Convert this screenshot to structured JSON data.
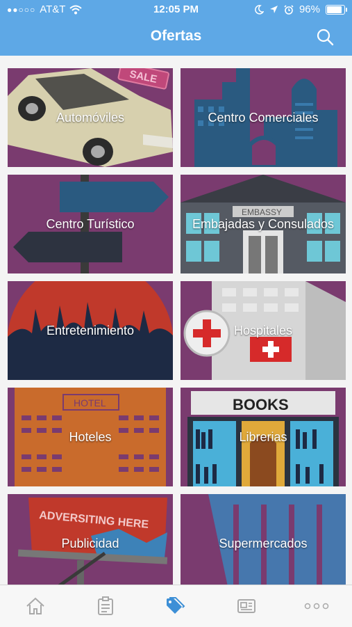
{
  "status_bar": {
    "carrier": "AT&T",
    "time": "12:05 PM",
    "battery": "96%",
    "battery_level": 0.96
  },
  "header": {
    "title": "Ofertas",
    "color": "#5ea8e6"
  },
  "categories": [
    {
      "label": "Automóviles",
      "icon": "car-image"
    },
    {
      "label": "Centro Comerciales",
      "icon": "buildings-image"
    },
    {
      "label": "Centro Turístico",
      "icon": "signpost-image"
    },
    {
      "label": "Embajadas y Consulados",
      "icon": "embassy-image",
      "sign": "EMBASSY"
    },
    {
      "label": "Entretenimiento",
      "icon": "crowd-image"
    },
    {
      "label": "Hospitales",
      "icon": "hospital-image"
    },
    {
      "label": "Hoteles",
      "icon": "hotel-image",
      "sign": "HOTEL"
    },
    {
      "label": "Librerias",
      "icon": "bookstore-image",
      "sign": "BOOKS"
    },
    {
      "label": "Publicidad",
      "icon": "billboard-image",
      "sign": "ADVERSITING HERE"
    },
    {
      "label": "Supermercados",
      "icon": "shopping-cart-image"
    }
  ],
  "car_tag": "SALE",
  "tabs": [
    {
      "name": "home",
      "icon": "home-icon",
      "active": false
    },
    {
      "name": "clipboard",
      "icon": "clipboard-icon",
      "active": false
    },
    {
      "name": "offers",
      "icon": "tag-icon",
      "active": true
    },
    {
      "name": "news",
      "icon": "newspaper-icon",
      "active": false
    },
    {
      "name": "more",
      "icon": "more-icon",
      "active": false
    }
  ],
  "colors": {
    "tile_purple": "#7a3b6f",
    "active_tab": "#3d8fd6",
    "inactive_tab": "#a9a9a9"
  }
}
